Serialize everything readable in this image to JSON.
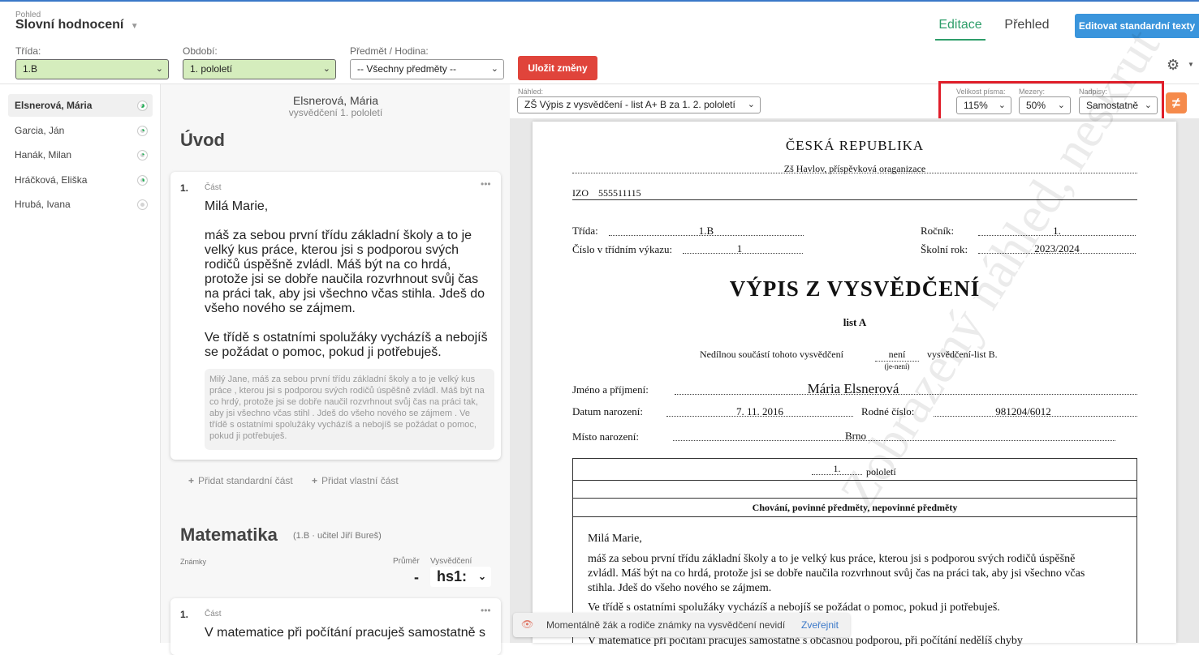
{
  "header": {
    "view_label": "Pohled",
    "view_title": "Slovní hodnocení",
    "tab_edit": "Editace",
    "tab_overview": "Přehled",
    "edit_texts_button": "Editovat standardní texty"
  },
  "filters": {
    "class_label": "Třída:",
    "class_value": "1.B",
    "period_label": "Období:",
    "period_value": "1. pololetí",
    "subject_label": "Předmět / Hodina:",
    "subject_value": "-- Všechny předměty --",
    "save_button": "Uložit změny"
  },
  "students": [
    {
      "name": "Elsnerová, Mária",
      "progress": 0.6
    },
    {
      "name": "Garcia, Ján",
      "progress": 0.3
    },
    {
      "name": "Hanák, Milan",
      "progress": 0.2
    },
    {
      "name": "Hráčková, Eliška",
      "progress": 0.4
    },
    {
      "name": "Hrubá, Ivana",
      "progress": 0.0
    }
  ],
  "editor": {
    "student_name": "Elsnerová, Mária",
    "subtitle": "vysvědčení 1. pololetí",
    "section_intro": "Úvod",
    "part_number": "1.",
    "part_label": "Část",
    "greeting": "Milá Marie,",
    "para1": "máš za sebou první třídu základní školy a to je velký kus práce, kterou jsi s podporou svých rodičů úspěšně zvládl. Máš být na co hrdá, protože  jsi se  dobře naučila rozvrhnout svůj čas na práci tak, aby jsi všechno včas stihla. Jdeš do všeho nového se zájmem.",
    "para2": "Ve třídě s ostatními spolužáky vycházíš  a nebojíš se požádat o pomoc, pokud ji potřebuješ.",
    "standard_text": "Milý Jane, máš za sebou první třídu základní školy a to je velký kus práce , kterou jsi s podporou svých rodičů úspěšně zvládl. Máš být na co hrdý, protože  jsi se  dobře naučil rozvrhnout svůj čas na práci tak, aby jsi všechno včas stihl . Jdeš do všeho nového se zájmem . Ve třídě s ostatními spolužáky vycházíš  a nebojíš se požádat o pomoc, pokud ji potřebuješ.",
    "add_standard": "Přidat standardní část",
    "add_custom": "Přidat vlastní část",
    "section_math": "Matematika",
    "math_info": "(1.B · učitel Jiří Bureš)",
    "grades_label": "Známky",
    "average_label": "Průměr",
    "report_label": "Vysvědčení",
    "average_value": "-",
    "report_value": "hs1:",
    "part2_number": "1.",
    "part2_label": "Část",
    "part2_text": "V matematice při počítání pracuješ samostatně s"
  },
  "preview": {
    "label": "Náhled:",
    "template": "ZŠ Výpis z vysvědčení - list A+ B za 1. 2. pololetí",
    "font_size_label": "Velikost písma:",
    "font_size": "115%",
    "spacing_label": "Mezery:",
    "spacing": "50%",
    "headings_label": "Nadpisy:",
    "headings": "Samostatně",
    "doc": {
      "country": "ČESKÁ REPUBLIKA",
      "school": "Zš Havlov, příspěvková oraganizace",
      "izo_label": "IZO",
      "izo": "555511115",
      "class_label": "Třída:",
      "class": "1.B",
      "year_label": "Ročník:",
      "year": "1.",
      "num_label": "Číslo v třídním výkazu:",
      "num": "1",
      "school_year_label": "Školní rok:",
      "school_year": "2023/2024",
      "title": "VÝPIS Z VYSVĚDČENÍ",
      "list": "list A",
      "note_pre": "Nedílnou součástí tohoto vysvědčení",
      "note_val": "není",
      "note_sub": "(je-není)",
      "note_post": "vysvědčení-list B.",
      "name_label": "Jméno a příjmení:",
      "name": "Mária Elsnerová",
      "birth_label": "Datum narození:",
      "birth": "7. 11. 2016",
      "rc_label": "Rodné číslo:",
      "rc": "981204/6012",
      "place_label": "Místo narození:",
      "place": "Brno",
      "period_num": "1.",
      "period_word": "pololetí",
      "subjects_header": "Chování, povinné předměty, nepovinné předměty",
      "greeting": "Milá Marie,",
      "p1": "máš za sebou první třídu základní školy a to je velký kus práce, kterou jsi s podporou svých rodičů úspěšně zvládl. Máš být na co hrdá, protože  jsi se  dobře naučila rozvrhnout svůj čas na práci tak, aby jsi všechno včas stihla. Jdeš do všeho nového se zájmem.",
      "p2": "Ve třídě s ostatními spolužáky vycházíš  a nebojíš se požádat o pomoc, pokud ji potřebuješ.",
      "p3": "V matematice při počítání pracuješ samostatně s občasnou podporou, při počítání nedělíš chyby",
      "watermark": "Zobrazený náhled, neskrut"
    }
  },
  "notice": {
    "text": "Momentálně žák a rodiče známky na vysvědčení nevidí",
    "publish": "Zveřejnit"
  },
  "colors": {
    "accent": "#3a95dc",
    "save": "#e0443b",
    "green_select": "#d5edbd",
    "highlight": "#e01e2a",
    "tab_green": "#2e9e6a"
  }
}
